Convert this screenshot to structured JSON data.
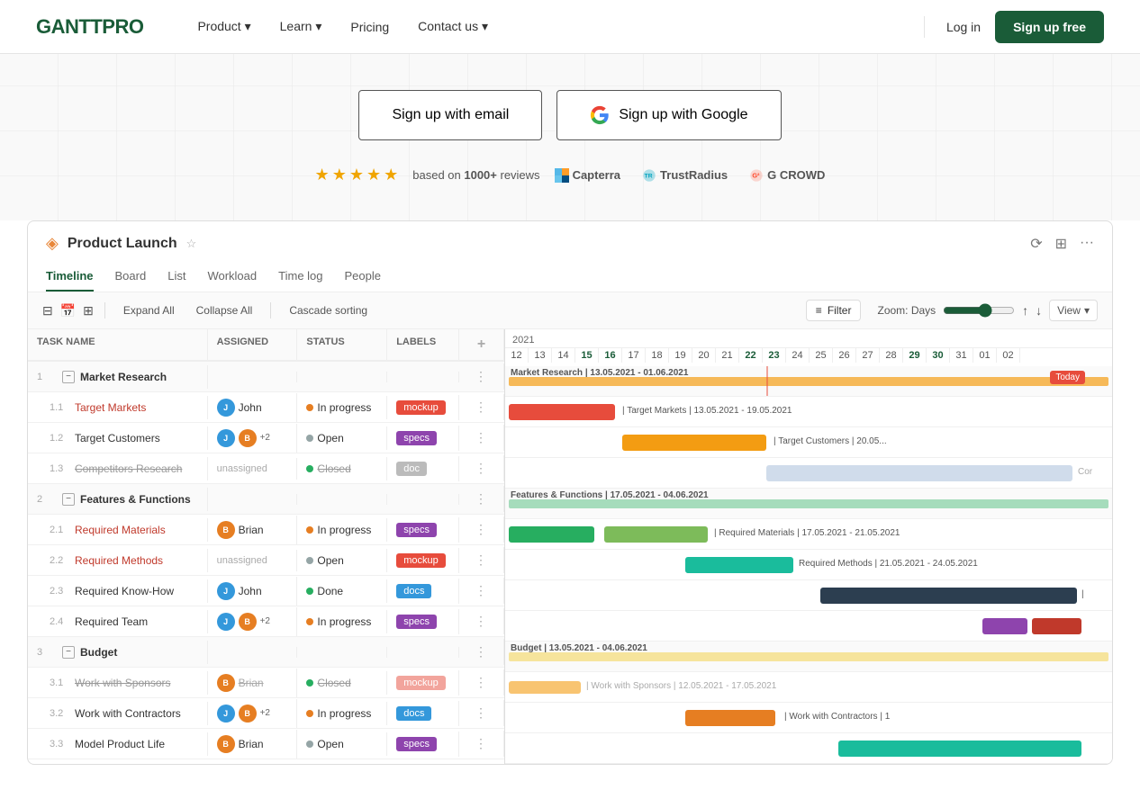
{
  "nav": {
    "logo": "GANTTPRO",
    "links": [
      {
        "label": "Product",
        "has_arrow": true
      },
      {
        "label": "Learn",
        "has_arrow": true
      },
      {
        "label": "Pricing",
        "has_arrow": false
      },
      {
        "label": "Contact us",
        "has_arrow": true
      }
    ],
    "login": "Log in",
    "signup": "Sign up free"
  },
  "hero": {
    "signup_email": "Sign up with email",
    "signup_google": "Sign up with Google",
    "reviews_text": "based on",
    "reviews_bold": "1000+",
    "reviews_suffix": "reviews",
    "stars": [
      "★",
      "★",
      "★",
      "★",
      "★"
    ],
    "logos": [
      "Capterra",
      "TrustRadius",
      "G CROWD"
    ]
  },
  "widget": {
    "title": "Product Launch",
    "tabs": [
      "Timeline",
      "Board",
      "List",
      "Workload",
      "Time log",
      "People"
    ],
    "active_tab": "Timeline",
    "toolbar": {
      "expand": "Expand All",
      "collapse": "Collapse All",
      "cascade": "Cascade sorting",
      "filter": "Filter",
      "zoom_label": "Zoom: Days",
      "view": "View"
    },
    "year": "2021",
    "dates": [
      "12",
      "13",
      "14",
      "15",
      "16",
      "17",
      "18",
      "19",
      "20",
      "21",
      "22",
      "23",
      "24",
      "25",
      "26",
      "27",
      "28",
      "29",
      "30",
      "31",
      "01",
      "02"
    ],
    "today": "Today",
    "tasks": [
      {
        "num": "1",
        "id": "",
        "name": "Market Research",
        "type": "group",
        "assigned": "",
        "status": "",
        "labels": "",
        "indent": 0
      },
      {
        "num": "1.1",
        "id": "1.1",
        "name": "Target Markets",
        "type": "link",
        "assigned": "John",
        "status": "In progress",
        "status_type": "inprogress",
        "labels": "mockup",
        "indent": 1
      },
      {
        "num": "1.2",
        "id": "1.2",
        "name": "Target Customers",
        "type": "normal",
        "assigned": "multi2",
        "status": "Open",
        "status_type": "open",
        "labels": "specs",
        "indent": 1
      },
      {
        "num": "1.3",
        "id": "1.3",
        "name": "Competitors Research",
        "type": "strikethrough",
        "assigned": "unassigned",
        "status": "Closed",
        "status_type": "closed",
        "labels": "grey",
        "indent": 1
      },
      {
        "num": "2",
        "id": "",
        "name": "Features & Functions",
        "type": "group",
        "assigned": "",
        "status": "",
        "labels": "",
        "indent": 0
      },
      {
        "num": "2.1",
        "id": "2.1",
        "name": "Required Materials",
        "type": "link",
        "assigned": "Brian",
        "status": "In progress",
        "status_type": "inprogress",
        "labels": "specs",
        "indent": 1
      },
      {
        "num": "2.2",
        "id": "2.2",
        "name": "Required Methods",
        "type": "link",
        "assigned": "unassigned",
        "status": "Open",
        "status_type": "open",
        "labels": "mockup",
        "indent": 1
      },
      {
        "num": "2.3",
        "id": "2.3",
        "name": "Required Know-How",
        "type": "normal",
        "assigned": "John",
        "status": "Done",
        "status_type": "done",
        "labels": "docs",
        "indent": 1
      },
      {
        "num": "2.4",
        "id": "2.4",
        "name": "Required Team",
        "type": "normal",
        "assigned": "multi2",
        "status": "In progress",
        "status_type": "inprogress",
        "labels": "specs",
        "indent": 1
      },
      {
        "num": "3",
        "id": "",
        "name": "Budget",
        "type": "group",
        "assigned": "",
        "status": "",
        "labels": "",
        "indent": 0
      },
      {
        "num": "3.1",
        "id": "3.1",
        "name": "Work with Sponsors",
        "type": "strikethrough",
        "assigned": "Brian",
        "status": "Closed",
        "status_type": "closed",
        "labels": "mockup",
        "indent": 1
      },
      {
        "num": "3.2",
        "id": "3.2",
        "name": "Work with Contractors",
        "type": "normal",
        "assigned": "multi2",
        "status": "In progress",
        "status_type": "inprogress",
        "labels": "docs",
        "indent": 1
      },
      {
        "num": "3.3",
        "id": "3.3",
        "name": "Model Product Life",
        "type": "normal",
        "assigned": "Brian",
        "status": "Open",
        "status_type": "open",
        "labels": "specs",
        "indent": 1
      }
    ],
    "col_headers": [
      "Task name",
      "Assigned",
      "Status",
      "Labels",
      ""
    ]
  }
}
